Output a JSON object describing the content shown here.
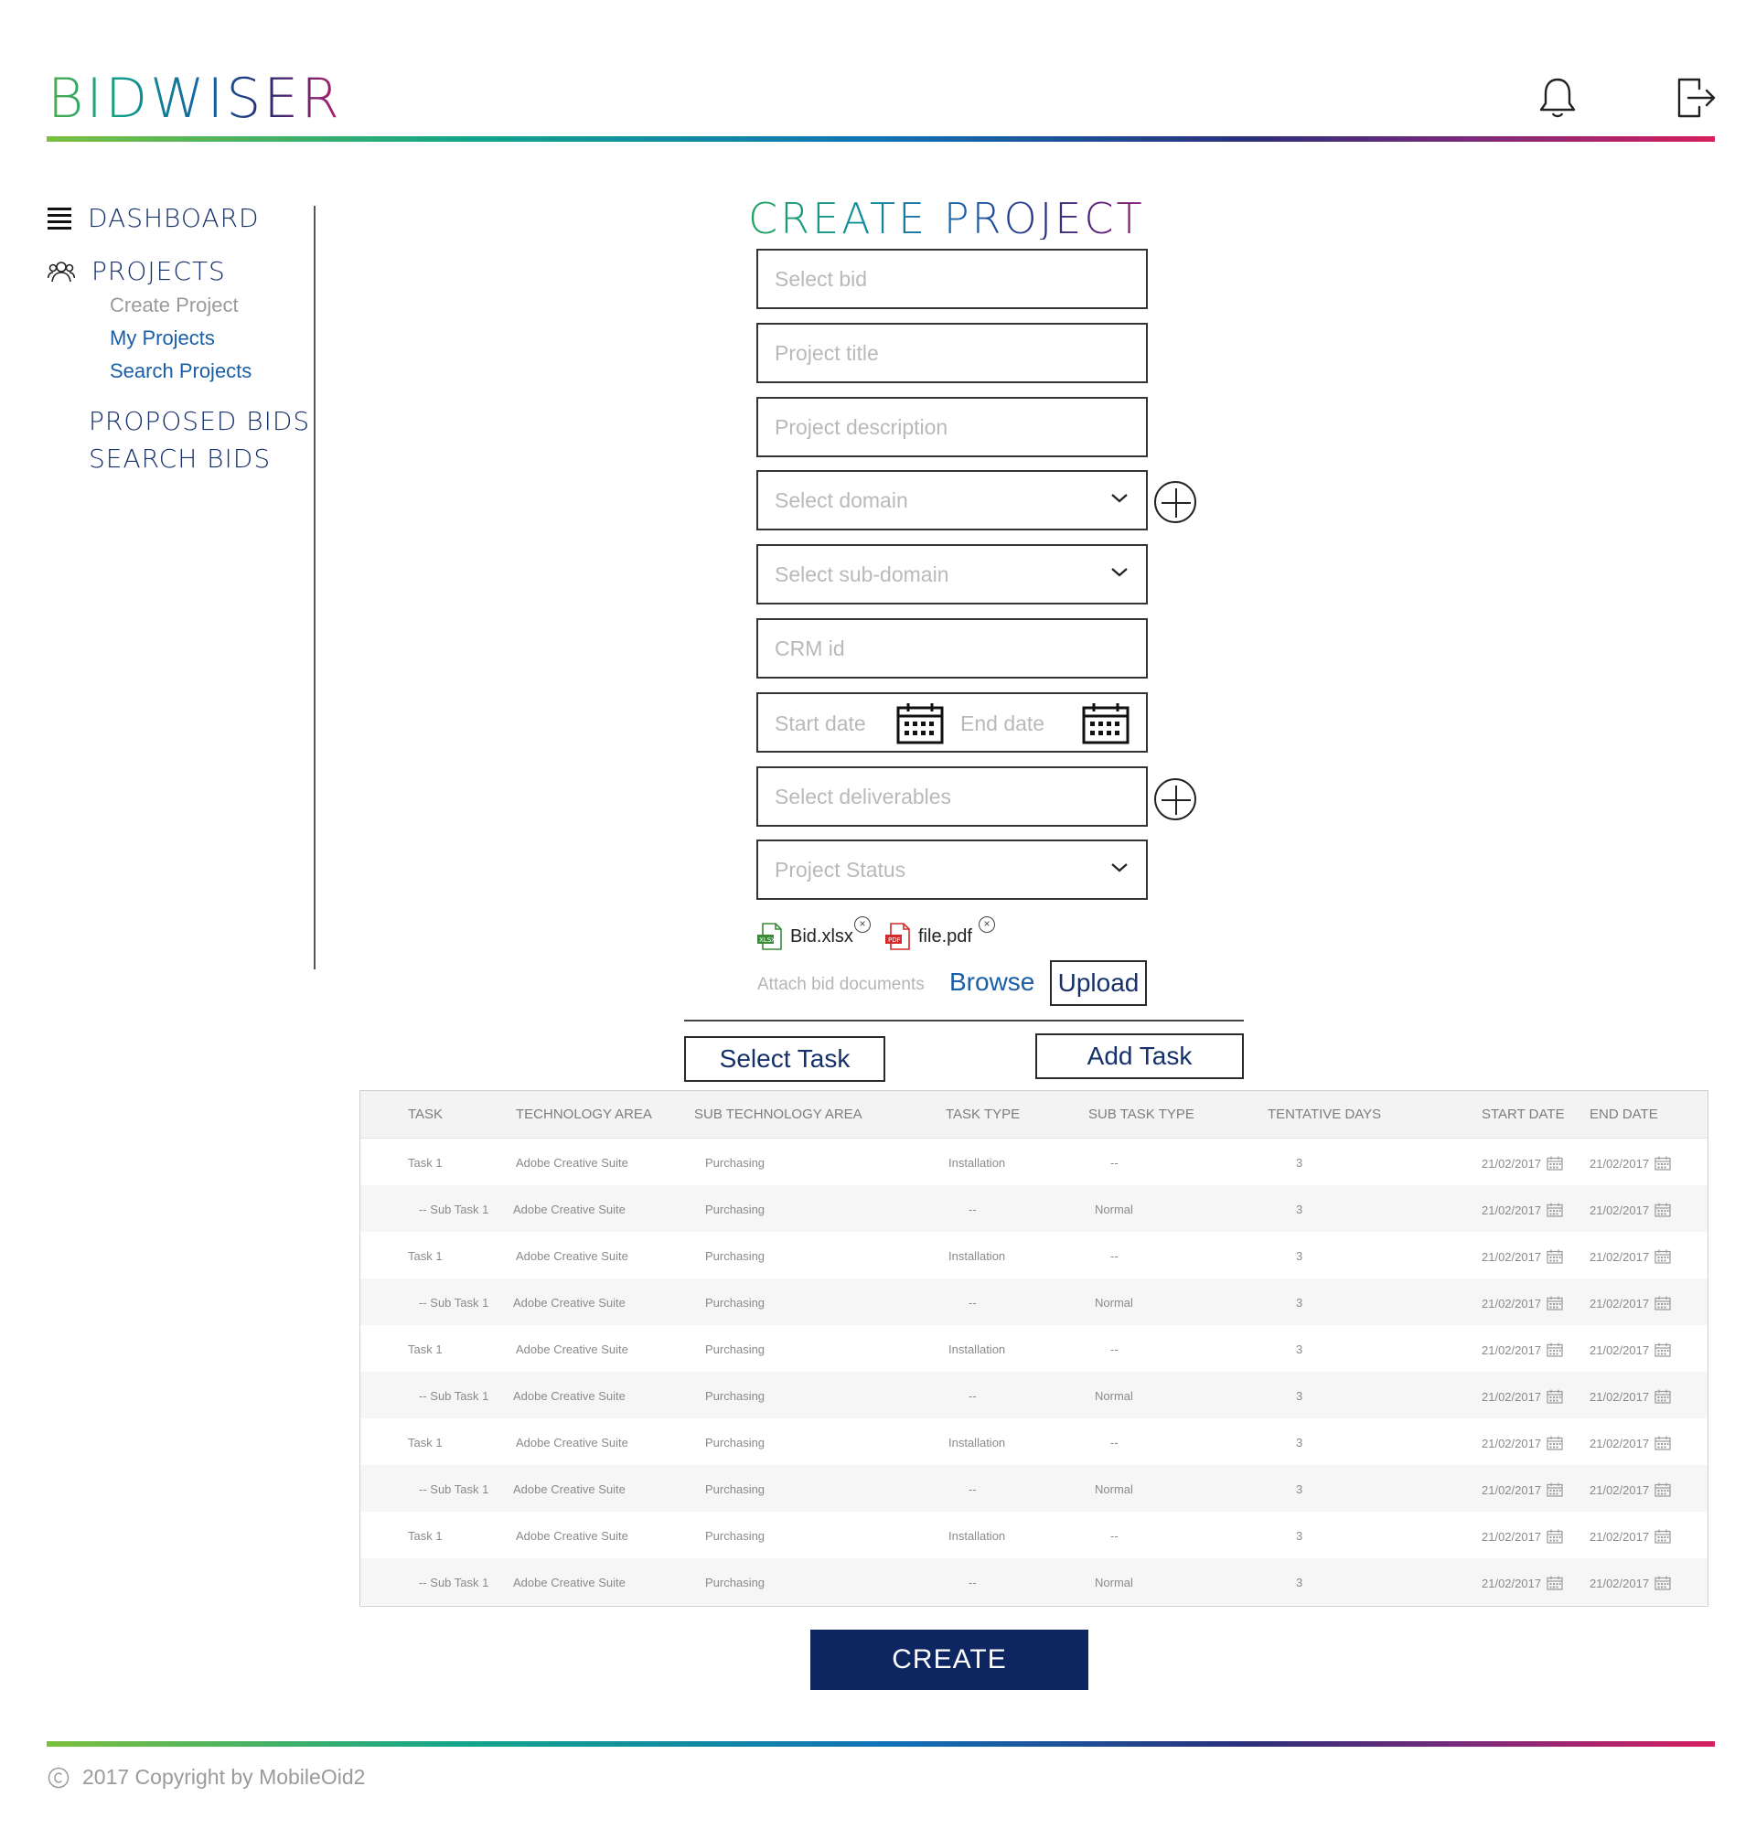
{
  "header": {
    "logo_text": "BIDWISER",
    "bell_icon": "bell-icon",
    "logout_icon": "logout-icon",
    "gradient_colors": [
      "#7cbf3e",
      "#12a58a",
      "#0f73b8",
      "#2b2f7a",
      "#d61f5f"
    ]
  },
  "sidebar": {
    "dashboard": "DASHBOARD",
    "projects": "PROJECTS",
    "project_subitems": [
      {
        "label": "Create Project",
        "state": "current"
      },
      {
        "label": "My Projects",
        "state": "link"
      },
      {
        "label": "Search Projects",
        "state": "link"
      }
    ],
    "proposed_bids": "PROPOSED BIDS",
    "search_bids": "SEARCH BIDS"
  },
  "form": {
    "title": "CREATE PROJECT",
    "select_bid": "Select bid",
    "project_title": "Project title",
    "project_description": "Project description",
    "select_domain": "Select domain",
    "select_subdomain": "Select sub-domain",
    "crm_id": "CRM id",
    "start_date": "Start date",
    "end_date": "End date",
    "select_deliverables": "Select deliverables",
    "project_status": "Project Status",
    "attachments": [
      {
        "name": "Bid.xlsx",
        "type": "xlsx",
        "color": "#3a8a3a"
      },
      {
        "name": "file.pdf",
        "type": "pdf",
        "color": "#d22a2a"
      }
    ],
    "attach_label": "Attach bid documents",
    "browse": "Browse",
    "upload": "Upload",
    "select_task": "Select Task",
    "add_task": "Add Task"
  },
  "table": {
    "headers": [
      "TASK",
      "TECHNOLOGY AREA",
      "SUB TECHNOLOGY AREA",
      "TASK TYPE",
      "SUB TASK TYPE",
      "TENTATIVE DAYS",
      "START DATE",
      "END DATE"
    ],
    "rows": [
      [
        "Task 1",
        "Adobe Creative Suite",
        "Purchasing",
        "Installation",
        "--",
        "3",
        "21/02/2017",
        "21/02/2017"
      ],
      [
        "-- Sub Task 1",
        "Adobe Creative Suite",
        "Purchasing",
        "--",
        "Normal",
        "3",
        "21/02/2017",
        "21/02/2017"
      ],
      [
        "Task 1",
        "Adobe Creative Suite",
        "Purchasing",
        "Installation",
        "--",
        "3",
        "21/02/2017",
        "21/02/2017"
      ],
      [
        "-- Sub Task 1",
        "Adobe Creative Suite",
        "Purchasing",
        "--",
        "Normal",
        "3",
        "21/02/2017",
        "21/02/2017"
      ],
      [
        "Task 1",
        "Adobe Creative Suite",
        "Purchasing",
        "Installation",
        "--",
        "3",
        "21/02/2017",
        "21/02/2017"
      ],
      [
        "-- Sub Task 1",
        "Adobe Creative Suite",
        "Purchasing",
        "--",
        "Normal",
        "3",
        "21/02/2017",
        "21/02/2017"
      ],
      [
        "Task 1",
        "Adobe Creative Suite",
        "Purchasing",
        "Installation",
        "--",
        "3",
        "21/02/2017",
        "21/02/2017"
      ],
      [
        "-- Sub Task 1",
        "Adobe Creative Suite",
        "Purchasing",
        "--",
        "Normal",
        "3",
        "21/02/2017",
        "21/02/2017"
      ],
      [
        "Task 1",
        "Adobe Creative Suite",
        "Purchasing",
        "Installation",
        "--",
        "3",
        "21/02/2017",
        "21/02/2017"
      ],
      [
        "-- Sub Task 1",
        "Adobe Creative Suite",
        "Purchasing",
        "--",
        "Normal",
        "3",
        "21/02/2017",
        "21/02/2017"
      ]
    ]
  },
  "create_button": "CREATE",
  "footer": {
    "copyright": "2017 Copyright by MobileOid2"
  },
  "colors": {
    "primary": "#0d2560",
    "link": "#1a5ea8",
    "placeholder": "#b9b9b9"
  }
}
